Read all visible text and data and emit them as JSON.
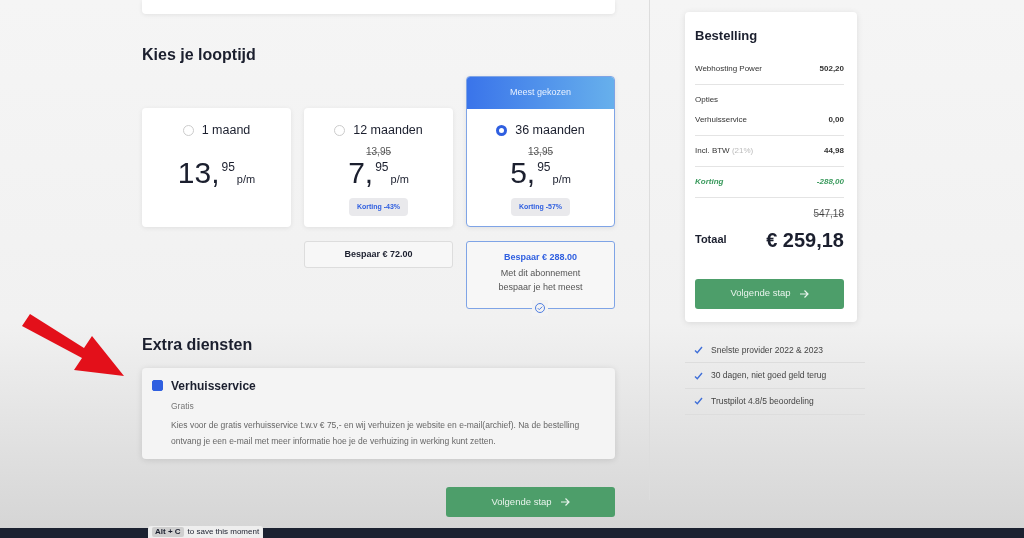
{
  "duration": {
    "title": "Kies je looptijd",
    "plans": [
      {
        "label": "1 maand",
        "selected": false,
        "price_whole": "13,",
        "price_cents": "95",
        "unit": "p/m"
      },
      {
        "label": "12 maanden",
        "selected": false,
        "old_price": "13,95",
        "price_whole": "7,",
        "price_cents": "95",
        "unit": "p/m",
        "discount": "Korting -43%",
        "savings": "Bespaar € 72.00"
      },
      {
        "label": "36 maanden",
        "selected": true,
        "ribbon": "Meest gekozen",
        "old_price": "13,95",
        "price_whole": "5,",
        "price_cents": "95",
        "unit": "p/m",
        "discount": "Korting -57%",
        "savings": "Bespaar € 288.00",
        "savings_note": "Met dit abonnement bespaar je het meest"
      }
    ]
  },
  "extras": {
    "title": "Extra diensten",
    "services": [
      {
        "name": "Verhuisservice",
        "checked": true,
        "price": "Gratis",
        "description": "Kies voor de gratis verhuisservice t.w.v € 75,- en wij verhuizen je website en e-mail(archief). Na de bestelling ontvang je een e-mail met meer informatie hoe je de verhuizing in werking kunt zetten."
      }
    ]
  },
  "next_button": "Volgende stap",
  "order": {
    "title": "Bestelling",
    "rows": [
      {
        "kind": "line",
        "label": "Webhosting Power",
        "value": "502,20"
      },
      {
        "kind": "group",
        "heading": "Opties",
        "label": "Verhuisservice",
        "value": "0,00"
      },
      {
        "kind": "line",
        "label": "Incl. BTW",
        "note": "(21%)",
        "value": "44,98"
      },
      {
        "kind": "discount",
        "label": "Korting",
        "value": "-288,00"
      }
    ],
    "old_total": "547,18",
    "total_label": "Totaal",
    "total": "€ 259,18",
    "button": "Volgende stap"
  },
  "usps": [
    "Snelste provider 2022 & 2023",
    "30 dagen, niet goed geld terug",
    "Trustpilot 4.8/5 beoordeling"
  ],
  "video_hint": {
    "key": "Alt + C",
    "text": "to save this moment"
  }
}
